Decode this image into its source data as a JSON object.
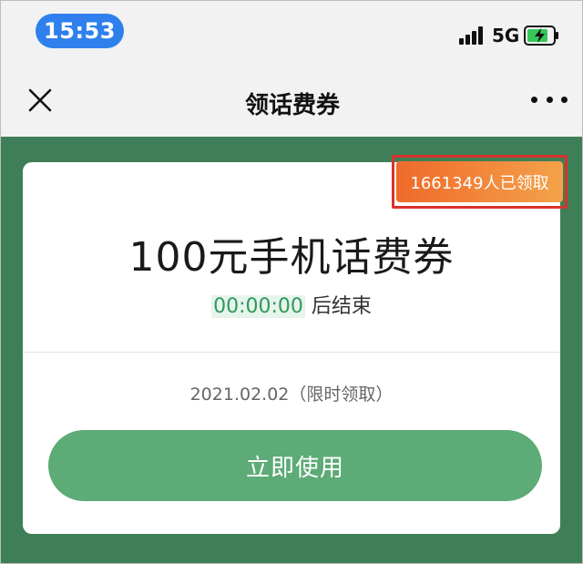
{
  "status_bar": {
    "time": "15:53",
    "network": "5G",
    "icons": [
      "signal-icon",
      "battery-charging-icon"
    ]
  },
  "nav": {
    "title": "领话费券",
    "close_icon": "close-icon",
    "more_icon": "more-icon"
  },
  "coupon": {
    "claimed_badge": "1661349人已领取",
    "title": "100元手机话费券",
    "countdown_time": "00:00:00",
    "countdown_suffix": " 后结束",
    "date_text": "2021.02.02（限时领取）",
    "button_label": "立即使用"
  },
  "colors": {
    "background_green": "#3f7f57",
    "button_green": "#5dab76",
    "badge_orange": "#f06a2a",
    "highlight_red": "#d9322c",
    "time_pill_blue": "#2f80ed"
  }
}
